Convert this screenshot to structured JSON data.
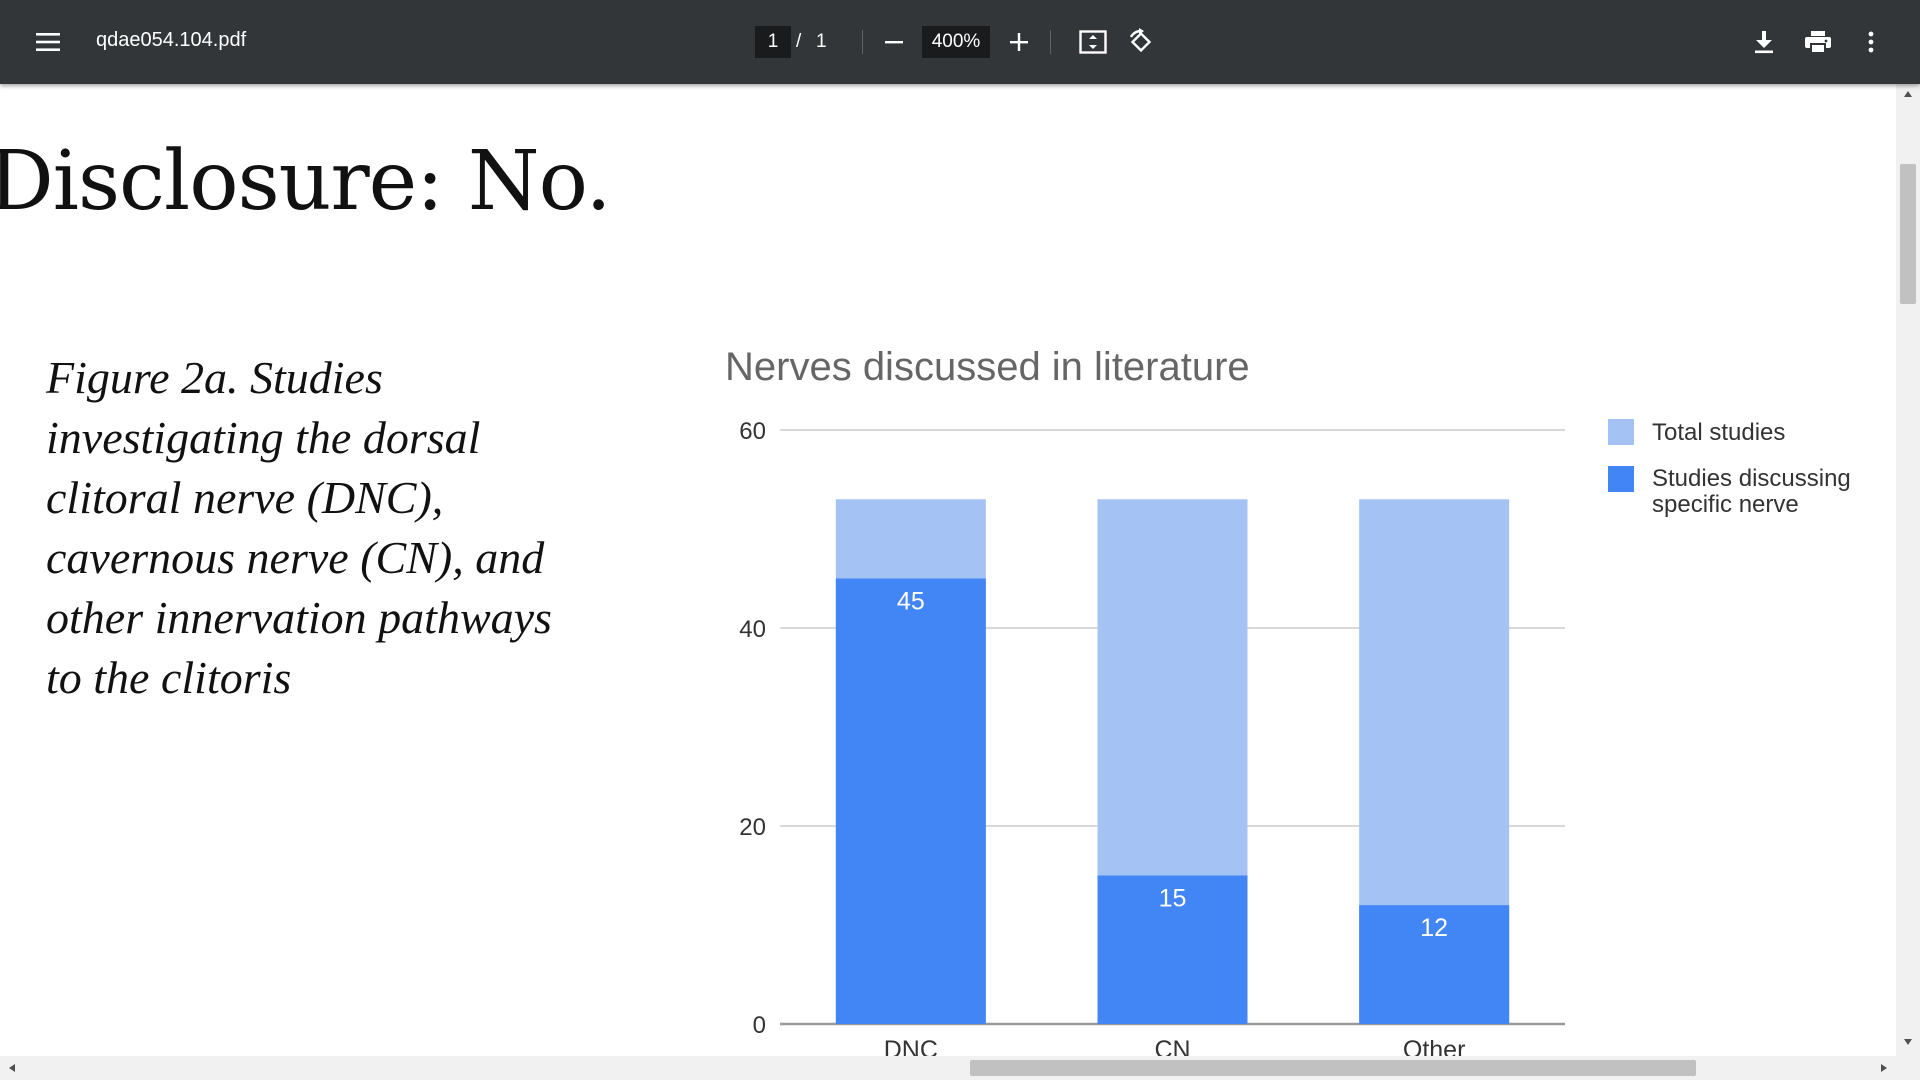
{
  "toolbar": {
    "file_name": "qdae054.104.pdf",
    "current_page": "1",
    "page_separator": "/",
    "total_pages": "1",
    "zoom": "400%"
  },
  "document": {
    "heading": "Disclosure: No.",
    "caption": "Figure 2a. Studies investigating the dorsal clitoral nerve (DNC), cavernous nerve (CN), and other innervation pathways to the clitoris"
  },
  "colors": {
    "total": "#a4c2f4",
    "specific": "#4285f4",
    "toolbar_bg": "#323639"
  },
  "chart_data": {
    "type": "bar",
    "title": "Nerves discussed in literature",
    "categories": [
      "DNC",
      "CN",
      "Other"
    ],
    "series": [
      {
        "name": "Total studies",
        "values": [
          53,
          53,
          53
        ]
      },
      {
        "name": "Studies discussing specific nerve",
        "values": [
          45,
          15,
          12
        ]
      }
    ],
    "data_labels": [
      "45",
      "15",
      "12"
    ],
    "ylim": [
      0,
      60
    ],
    "yticks": [
      0,
      20,
      40,
      60
    ],
    "grid": true,
    "legend_position": "right",
    "legend": [
      "Total studies",
      "Studies discussing specific nerve"
    ]
  }
}
